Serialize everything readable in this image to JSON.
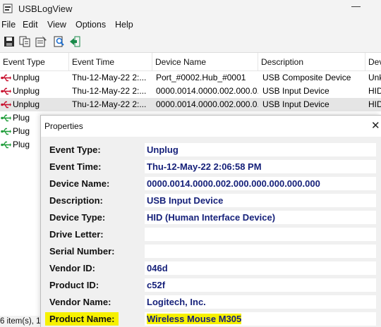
{
  "window": {
    "title": "USBLogView",
    "minimize_glyph": "—"
  },
  "menu": [
    "File",
    "Edit",
    "View",
    "Options",
    "Help"
  ],
  "toolbar": [
    {
      "name": "save-icon"
    },
    {
      "name": "copy-icon"
    },
    {
      "name": "properties-icon"
    },
    {
      "name": "find-icon"
    },
    {
      "name": "exit-icon"
    }
  ],
  "columns": [
    "Event Type",
    "Event Time",
    "Device Name",
    "Description",
    "Dev"
  ],
  "rows": [
    {
      "event_type": "Unplug",
      "event_time": "Thu-12-May-22 2:...",
      "device_name": "Port_#0002.Hub_#0001",
      "description": "USB Composite Device",
      "device_type": "Unk",
      "icon": "usb-unplug-icon"
    },
    {
      "event_type": "Unplug",
      "event_time": "Thu-12-May-22 2:...",
      "device_name": "0000.0014.0000.002.000.0...",
      "description": "USB Input Device",
      "device_type": "HID",
      "icon": "usb-unplug-icon"
    },
    {
      "event_type": "Unplug",
      "event_time": "Thu-12-May-22 2:...",
      "device_name": "0000.0014.0000.002.000.0...",
      "description": "USB Input Device",
      "device_type": "HID",
      "icon": "usb-unplug-icon"
    },
    {
      "event_type": "Plug",
      "event_time": "",
      "device_name": "",
      "description": "",
      "device_type": "",
      "icon": "usb-plug-icon"
    },
    {
      "event_type": "Plug",
      "event_time": "",
      "device_name": "",
      "description": "",
      "device_type": "",
      "icon": "usb-plug-icon"
    },
    {
      "event_type": "Plug",
      "event_time": "",
      "device_name": "",
      "description": "",
      "device_type": "",
      "icon": "usb-plug-icon"
    }
  ],
  "status": {
    "text": "6 item(s), 1"
  },
  "dialog": {
    "title": "Properties",
    "close_glyph": "✕",
    "fields": [
      {
        "label": "Event Type:",
        "value": "Unplug",
        "highlight": false
      },
      {
        "label": "Event Time:",
        "value": "Thu-12-May-22 2:06:58 PM",
        "highlight": false
      },
      {
        "label": "Device Name:",
        "value": "0000.0014.0000.002.000.000.000.000.000",
        "highlight": false
      },
      {
        "label": "Description:",
        "value": "USB Input Device",
        "highlight": false
      },
      {
        "label": "Device Type:",
        "value": "HID (Human Interface Device)",
        "highlight": false
      },
      {
        "label": "Drive Letter:",
        "value": "",
        "highlight": false
      },
      {
        "label": "Serial Number:",
        "value": "",
        "highlight": false
      },
      {
        "label": "Vendor ID:",
        "value": "046d",
        "highlight": false
      },
      {
        "label": "Product ID:",
        "value": "c52f",
        "highlight": false
      },
      {
        "label": "Vendor Name:",
        "value": "Logitech, Inc.",
        "highlight": false
      },
      {
        "label": "Product Name:",
        "value": "Wireless Mouse M305",
        "highlight": true
      }
    ]
  },
  "colors": {
    "value_text": "#16217a",
    "highlight": "#f6f100",
    "unplug_icon": "#c8102e",
    "plug_icon": "#1f9d3a"
  }
}
